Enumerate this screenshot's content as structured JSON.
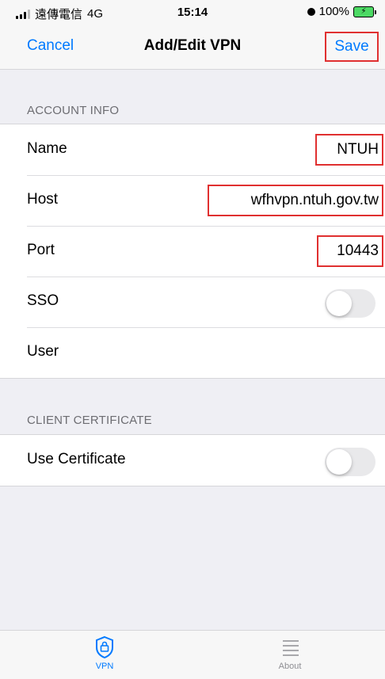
{
  "status_bar": {
    "carrier": "遠傳電信",
    "network": "4G",
    "time": "15:14",
    "battery": "100%",
    "icons": [
      "signal-icon",
      "alarm-icon",
      "battery-charging-icon"
    ]
  },
  "nav": {
    "cancel_label": "Cancel",
    "title": "Add/Edit VPN",
    "save_label": "Save"
  },
  "account_info": {
    "header": "ACCOUNT INFO",
    "fields": {
      "name": {
        "label": "Name",
        "value": "NTUH"
      },
      "host": {
        "label": "Host",
        "value": "wfhvpn.ntuh.gov.tw"
      },
      "port": {
        "label": "Port",
        "value": "10443"
      },
      "sso": {
        "label": "SSO",
        "enabled": false
      },
      "user": {
        "label": "User",
        "value": ""
      }
    }
  },
  "client_certificate": {
    "header": "CLIENT CERTIFICATE",
    "use_certificate": {
      "label": "Use Certificate",
      "enabled": false
    }
  },
  "tabs": [
    {
      "label": "VPN",
      "icon": "shield-lock-icon",
      "selected": true
    },
    {
      "label": "About",
      "icon": "list-icon",
      "selected": false
    }
  ],
  "colors": {
    "accent": "#007aff",
    "highlight_box": "#e03030",
    "background": "#efeff4",
    "toggle_off": "#e9e9eb"
  }
}
